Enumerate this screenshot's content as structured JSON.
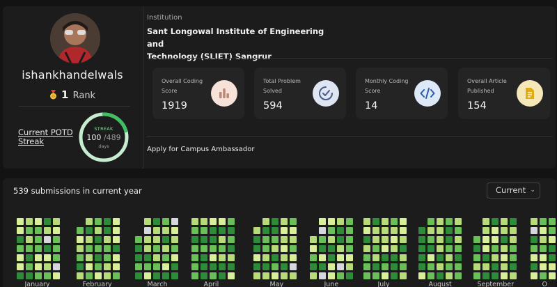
{
  "profile": {
    "username": "ishankhandelwals",
    "rank_number": "1",
    "rank_label": "Rank",
    "potd_label": "Current POTD Streak",
    "streak": {
      "title": "STREAK",
      "current": "100",
      "total": "/489",
      "unit": "days",
      "progress": 0.2045
    }
  },
  "institution": {
    "label": "Institution",
    "name_line1": "Sant Longowal Institute of Engineering and",
    "name_line2": "Technology (SLIET) Sangrur"
  },
  "stats": [
    {
      "label": "Overall Coding Score",
      "value": "1919",
      "icon": "bar-chart-icon",
      "icon_bg": "#f6e2d8",
      "icon_color": "#b88a76"
    },
    {
      "label": "Total Problem Solved",
      "value": "594",
      "icon": "check-circle-icon",
      "icon_bg": "#dfe6f3",
      "icon_color": "#4a5b86"
    },
    {
      "label": "Monthly Coding Score",
      "value": "14",
      "icon": "code-icon",
      "icon_bg": "#dde9f7",
      "icon_color": "#2c5aa8"
    },
    {
      "label": "Overall Article Published",
      "value": "154",
      "icon": "article-icon",
      "icon_bg": "#f6e7b9",
      "icon_color": "#d4a418"
    }
  ],
  "ambassador": "Apply for Campus Ambassador",
  "heatmap": {
    "title": "539 submissions in current year",
    "select_value": "Current",
    "months": [
      "January",
      "February",
      "March",
      "April",
      "May",
      "June",
      "July",
      "August",
      "September",
      "O"
    ],
    "colors": {
      "dark": "#2e8b3a",
      "mid": "#6bbf59",
      "light": "#b7db79",
      "pale": "#d9ee99",
      "none": "#d6d6de"
    }
  }
}
